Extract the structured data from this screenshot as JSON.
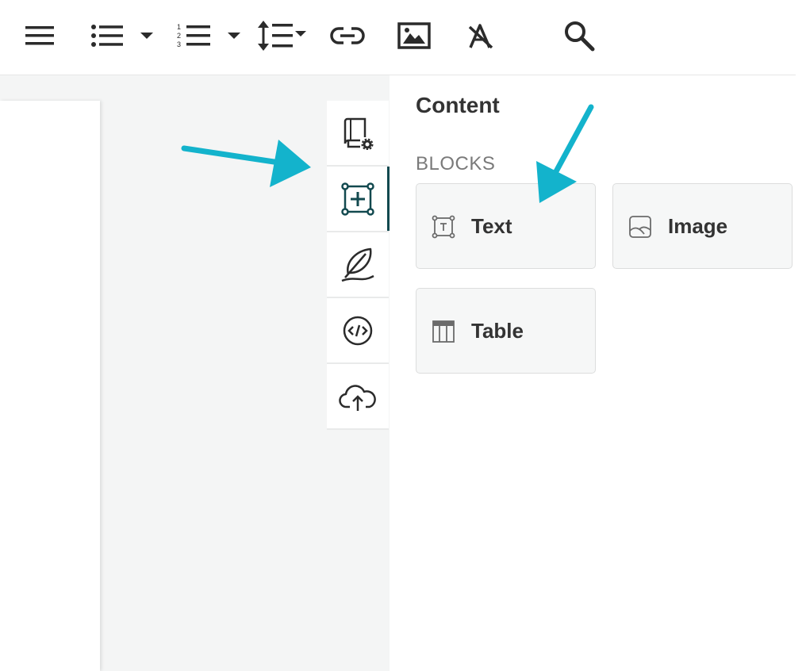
{
  "toolbar": {
    "buttons": [
      {
        "name": "align-icon"
      },
      {
        "name": "bulleted-list-icon"
      },
      {
        "name": "bulleted-list-dropdown-icon"
      },
      {
        "name": "numbered-list-icon"
      },
      {
        "name": "numbered-list-dropdown-icon"
      },
      {
        "name": "line-height-icon"
      },
      {
        "name": "link-icon"
      },
      {
        "name": "image-icon"
      },
      {
        "name": "clear-format-icon"
      },
      {
        "name": "search-icon"
      }
    ]
  },
  "side_tabs": [
    {
      "name": "book-settings-icon",
      "active": false
    },
    {
      "name": "add-block-icon",
      "active": true
    },
    {
      "name": "feather-icon",
      "active": false
    },
    {
      "name": "code-icon",
      "active": false
    },
    {
      "name": "cloud-upload-icon",
      "active": false
    }
  ],
  "panel": {
    "title": "Content",
    "section_label": "BLOCKS",
    "blocks": [
      {
        "label": "Text",
        "icon": "text-block-icon"
      },
      {
        "label": "Image",
        "icon": "image-block-icon"
      },
      {
        "label": "Table",
        "icon": "table-block-icon"
      }
    ]
  },
  "colors": {
    "accent": "#12494f",
    "annotation_arrow": "#13b3cc",
    "canvas_bg": "#f4f5f5",
    "block_bg": "#f6f7f7"
  }
}
